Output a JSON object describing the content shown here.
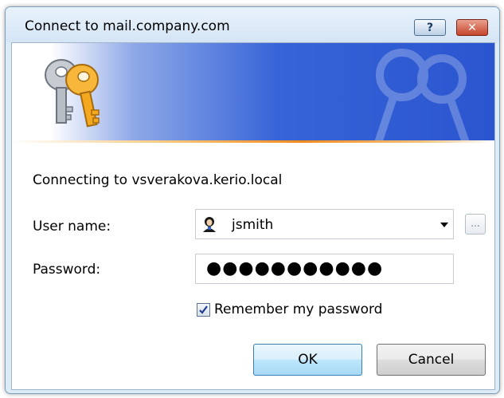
{
  "window": {
    "title": "Connect to mail.company.com"
  },
  "titlebar_buttons": {
    "help_label": "?",
    "close_label": "✕"
  },
  "dialog": {
    "connecting_text": "Connecting to vsverakova.kerio.local",
    "user_label": "User name:",
    "user_value": "jsmith",
    "password_label": "Password:",
    "password_mask": "●●●●●●●●●●●",
    "browse_label": "...",
    "remember_label": "Remember my password",
    "remember_checked": true,
    "ok_label": "OK",
    "cancel_label": "Cancel"
  },
  "icons": {
    "banner": "keys-icon",
    "user": "user-icon",
    "dropdown": "chevron-down-icon",
    "check": "checkmark-icon"
  },
  "colors": {
    "banner_blue": "#2a55cf",
    "accent_orange": "#f08a1c",
    "close_red": "#c5452c"
  }
}
